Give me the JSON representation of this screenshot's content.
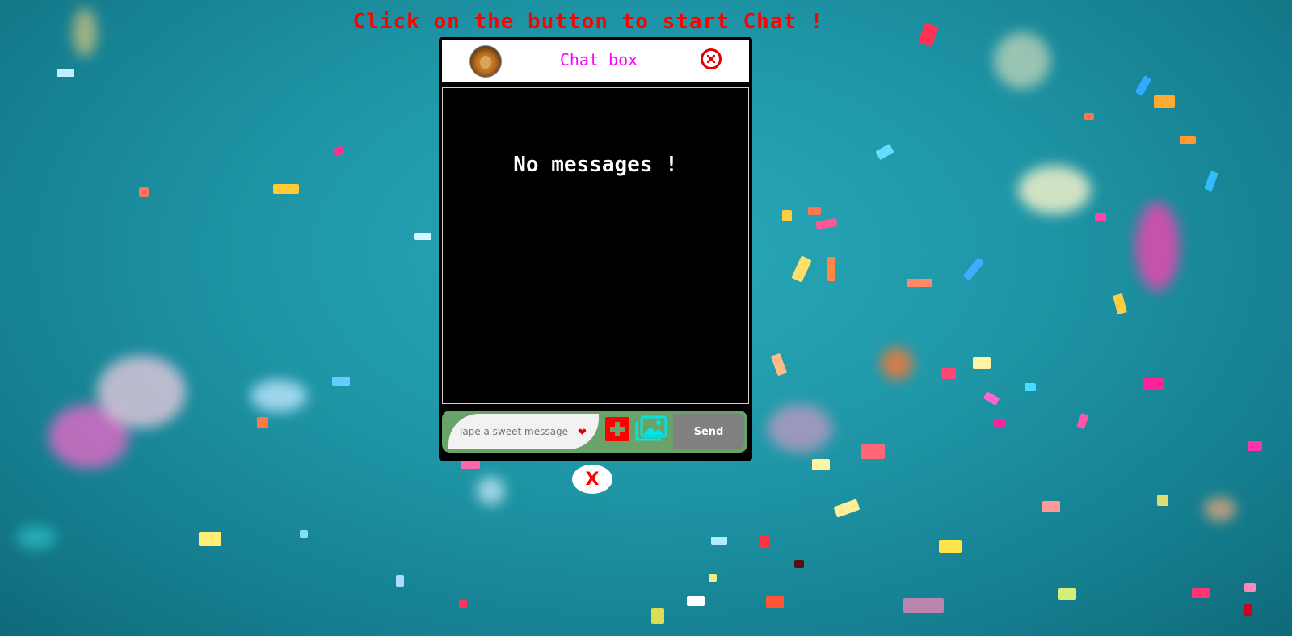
{
  "page": {
    "headline": "Click on the button to start Chat !"
  },
  "chat": {
    "title": "Chat box",
    "empty_text": "No messages !",
    "input_placeholder": "Tape a sweet message",
    "send_label": "Send",
    "toggle_label": "X"
  },
  "icons": {
    "avatar": "lion-avatar-icon",
    "close": "close-circle-icon",
    "heart": "heart-icon",
    "add": "plus-icon",
    "image": "image-icon"
  },
  "colors": {
    "headline": "#ff0000",
    "title": "#ff00ff",
    "composer_bg": "#6aa36a",
    "send_bg": "#808080",
    "add_bg": "#ff0000",
    "image_icon": "#00e5e5"
  }
}
